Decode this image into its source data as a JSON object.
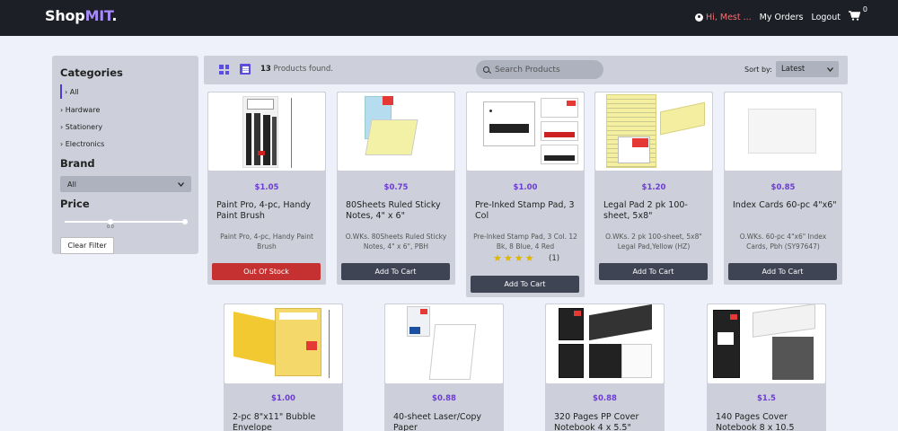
{
  "header": {
    "brand_main": "Shop",
    "brand_accent": "MIT",
    "brand_dot": ".",
    "user_greeting": "Hi, Mest ...",
    "my_orders": "My Orders",
    "logout": "Logout",
    "cart_count": "0"
  },
  "sidebar": {
    "categories_title": "Categories",
    "categories": [
      {
        "label": "› All",
        "active": true
      },
      {
        "label": "› Hardware"
      },
      {
        "label": "› Stationery"
      },
      {
        "label": "› Electronics"
      }
    ],
    "brand_title": "Brand",
    "brand_value": "All",
    "price_title": "Price",
    "price_slider_label": "0.0",
    "clear_filter": "Clear Filter"
  },
  "toolbar": {
    "count_number": "13",
    "count_text": " Products found.",
    "search_placeholder": "Search Products",
    "sort_label": "Sort by:",
    "sort_value": "Latest"
  },
  "products": [
    {
      "price": "$1.05",
      "name": "Paint Pro, 4-pc, Handy Paint Brush",
      "desc": "Paint Pro, 4-pc, Handy Paint Brush",
      "button": "Out Of Stock"
    },
    {
      "price": "$0.75",
      "name": "80Sheets Ruled Sticky Notes, 4\" x 6\"",
      "desc": "O.WKs. 80Sheets Ruled Sticky Notes, 4\" x 6\", PBH",
      "button": "Add To Cart"
    },
    {
      "price": "$1.00",
      "name": "Pre-Inked Stamp Pad, 3 Col",
      "desc": "Pre-Inked Stamp Pad, 3 Col. 12 Bk, 8 Blue, 4 Red",
      "stars": "★★★★",
      "rating_count": "(1)",
      "button": "Add To Cart"
    },
    {
      "price": "$1.20",
      "name": "Legal Pad 2 pk 100-sheet, 5x8\"",
      "desc": "O.WKs. 2 pk 100-sheet, 5x8\" Legal Pad,Yellow (HZ)",
      "button": "Add To Cart"
    },
    {
      "price": "$0.85",
      "name": "Index Cards 60-pc 4\"x6\"",
      "desc": "O.WKs. 60-pc 4\"x6\" Index Cards, Pbh (SY97647)",
      "button": "Add To Cart"
    },
    {
      "price": "$1.00",
      "name": "2-pc 8\"x11\" Bubble Envelope"
    },
    {
      "price": "$0.88",
      "name": "40-sheet Laser/Copy Paper"
    },
    {
      "price": "$0.88",
      "name": "320 Pages PP Cover Notebook 4 x 5.5\""
    },
    {
      "price": "$1.5",
      "name": "140 Pages Cover Notebook 8 x 10.5"
    }
  ],
  "colors": {
    "header_bg": "#1c1f26",
    "accent": "#5b4de0",
    "price": "#6d3bd6",
    "danger": "#c53030",
    "panel": "#cdd0da"
  }
}
